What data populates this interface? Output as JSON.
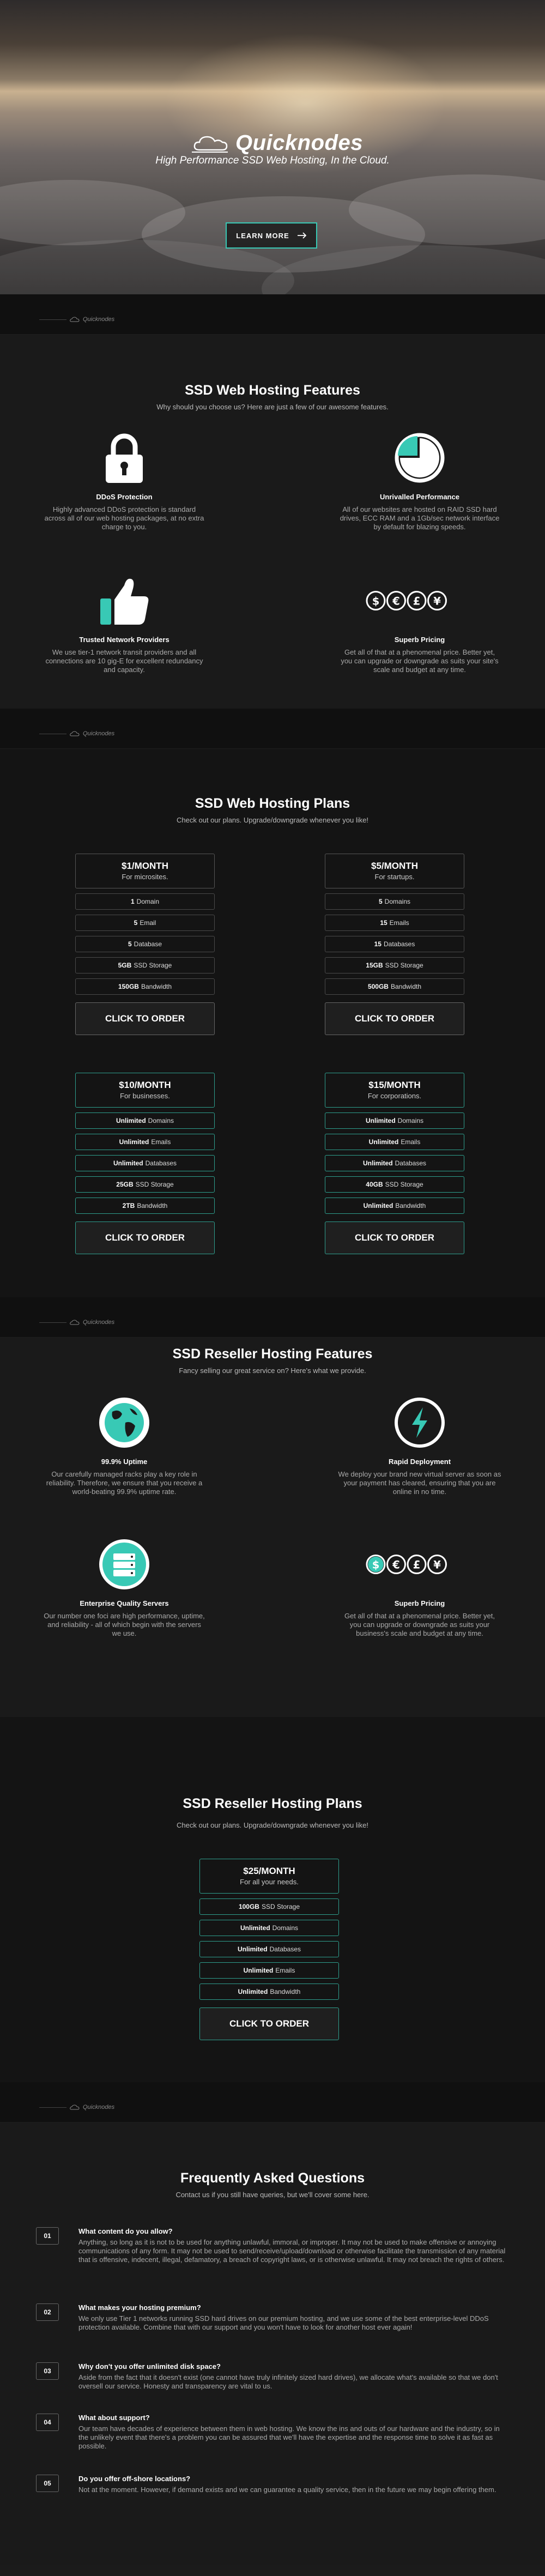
{
  "hero": {
    "brand": "Quicknodes",
    "tagline": "High Performance SSD Web Hosting, In the Cloud.",
    "cta": "LEARN MORE",
    "cta_icon": "arrow-right-icon"
  },
  "divider_label": "Quicknodes",
  "web_features": {
    "title": "SSD Web Hosting Features",
    "subtitle": "Why should you choose us? Here are just a few of our awesome features.",
    "items": [
      {
        "icon": "padlock-icon",
        "title": "DDoS Protection",
        "desc": "Highly advanced DDoS protection is standard across all of our web hosting packages, at no extra charge to you."
      },
      {
        "icon": "pie-chart-icon",
        "title": "Unrivalled Performance",
        "desc": "All of our websites are hosted on RAID SSD hard drives, ECC RAM and a 1Gb/sec network interface by default for blazing speeds."
      },
      {
        "icon": "thumbs-up-icon",
        "title": "Trusted Network Providers",
        "desc": "We use tier-1 network transit providers and all connections are 10 gig-E for excellent redundancy and capacity."
      },
      {
        "icon": "currency-icon",
        "title": "Superb Pricing",
        "desc": "Get all of that at a phenomenal price. Better yet, you can upgrade or downgrade as suits your site's scale and budget at any time."
      }
    ]
  },
  "web_plans": {
    "title": "SSD Web Hosting Plans",
    "subtitle": "Check out our plans. Upgrade/downgrade whenever you like!",
    "plans": [
      {
        "price": "$1/MONTH",
        "for": "For microsites.",
        "rows": [
          [
            "1",
            "Domain"
          ],
          [
            "5",
            "Email"
          ],
          [
            "5",
            "Database"
          ],
          [
            "5GB",
            "SSD Storage"
          ],
          [
            "150GB",
            "Bandwidth"
          ]
        ],
        "cta": "CLICK TO ORDER"
      },
      {
        "price": "$5/MONTH",
        "for": "For startups.",
        "rows": [
          [
            "5",
            "Domains"
          ],
          [
            "15",
            "Emails"
          ],
          [
            "15",
            "Databases"
          ],
          [
            "15GB",
            "SSD Storage"
          ],
          [
            "500GB",
            "Bandwidth"
          ]
        ],
        "cta": "CLICK TO ORDER"
      },
      {
        "price": "$10/MONTH",
        "for": "For businesses.",
        "rows": [
          [
            "Unlimited",
            "Domains"
          ],
          [
            "Unlimited",
            "Emails"
          ],
          [
            "Unlimited",
            "Databases"
          ],
          [
            "25GB",
            "SSD Storage"
          ],
          [
            "2TB",
            "Bandwidth"
          ]
        ],
        "cta": "CLICK TO ORDER"
      },
      {
        "price": "$15/MONTH",
        "for": "For corporations.",
        "rows": [
          [
            "Unlimited",
            "Domains"
          ],
          [
            "Unlimited",
            "Emails"
          ],
          [
            "Unlimited",
            "Databases"
          ],
          [
            "40GB",
            "SSD Storage"
          ],
          [
            "Unlimited",
            "Bandwidth"
          ]
        ],
        "cta": "CLICK TO ORDER"
      }
    ]
  },
  "reseller_features": {
    "title": "SSD Reseller Hosting Features",
    "subtitle": "Fancy selling our great service on? Here's what we provide.",
    "items": [
      {
        "icon": "globe-icon",
        "title": "99.9% Uptime",
        "desc": "Our carefully managed racks play a key role in reliability. Therefore, we ensure that you receive a world-beating 99.9% uptime rate."
      },
      {
        "icon": "lightning-icon",
        "title": "Rapid Deployment",
        "desc": "We deploy your brand new virtual server as soon as your payment has cleared, ensuring that you are online in no time."
      },
      {
        "icon": "server-icon",
        "title": "Enterprise Quality Servers",
        "desc": "Our number one foci are high performance, uptime, and reliability - all of which begin with the servers we use."
      },
      {
        "icon": "currency-icon",
        "title": "Superb Pricing",
        "desc": "Get all of that at a phenomenal price. Better yet, you can upgrade or downgrade as suits your business's scale and budget at any time."
      }
    ]
  },
  "reseller_plans": {
    "title": "SSD Reseller Hosting Plans",
    "subtitle": "Check out our plans. Upgrade/downgrade whenever you like!",
    "plan": {
      "price": "$25/MONTH",
      "for": "For all your needs.",
      "rows": [
        [
          "100GB",
          "SSD Storage"
        ],
        [
          "Unlimited",
          "Domains"
        ],
        [
          "Unlimited",
          "Databases"
        ],
        [
          "Unlimited",
          "Emails"
        ],
        [
          "Unlimited",
          "Bandwidth"
        ]
      ],
      "cta": "CLICK TO ORDER"
    }
  },
  "faq": {
    "title": "Frequently Asked Questions",
    "subtitle": "Contact us if you still have queries, but we'll cover some here.",
    "items": [
      {
        "num": "01",
        "q": "What content do you allow?",
        "a": "Anything, so long as it is not to be used for anything unlawful, immoral, or improper. It may not be used to make offensive or annoying communications of any form. It may not be used to send/receive/upload/download or otherwise facilitate the transmission of any material that is offensive, indecent, illegal, defamatory, a breach of copyright laws, or is otherwise unlawful. It may not breach the rights of others."
      },
      {
        "num": "02",
        "q": "What makes your hosting premium?",
        "a": "We only use Tier 1 networks running SSD hard drives on our premium hosting, and we use some of the best enterprise-level DDoS protection available. Combine that with our support and you won't have to look for another host ever again!"
      },
      {
        "num": "03",
        "q": "Why don't you offer unlimited disk space?",
        "a": "Aside from the fact that it doesn't exist (one cannot have truly infinitely sized hard drives), we allocate what's available so that we don't oversell our service. Honesty and transparency are vital to us."
      },
      {
        "num": "04",
        "q": "What about support?",
        "a": "Our team have decades of experience between them in web hosting. We know the ins and outs of our hardware and the industry, so in the unlikely event that there's a problem you can be assured that we'll have the expertise and the response time to solve it as fast as possible."
      },
      {
        "num": "05",
        "q": "Do you offer off-shore locations?",
        "a": "Not at the moment. However, if demand exists and we can guarantee a quality service, then in the future we may begin offering them."
      }
    ]
  },
  "colors": {
    "accent": "#38c9b5",
    "background": "#1a1a1a"
  }
}
